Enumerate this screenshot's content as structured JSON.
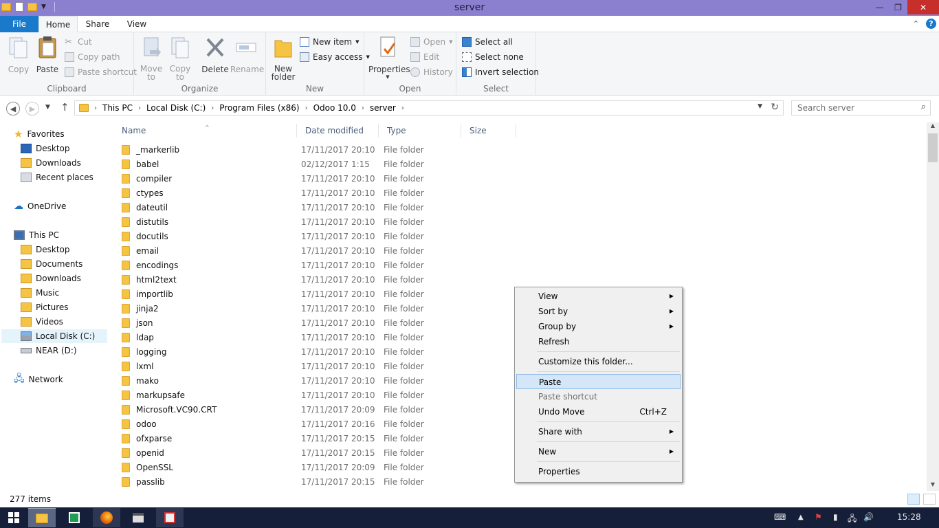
{
  "window": {
    "title": "server"
  },
  "ribbon_tabs": {
    "file": "File",
    "home": "Home",
    "share": "Share",
    "view": "View"
  },
  "clipboard": {
    "copy": "Copy",
    "paste": "Paste",
    "cut": "Cut",
    "copy_path": "Copy path",
    "paste_shortcut": "Paste shortcut",
    "label": "Clipboard"
  },
  "organize": {
    "move_to_1": "Move",
    "move_to_2": "to",
    "copy_to_1": "Copy",
    "copy_to_2": "to",
    "delete": "Delete",
    "rename": "Rename",
    "label": "Organize"
  },
  "new_group": {
    "new_folder_1": "New",
    "new_folder_2": "folder",
    "new_item": "New item",
    "easy_access": "Easy access",
    "label": "New"
  },
  "open_group": {
    "properties": "Properties",
    "open": "Open",
    "edit": "Edit",
    "history": "History",
    "label": "Open"
  },
  "select_group": {
    "select_all": "Select all",
    "select_none": "Select none",
    "invert": "Invert selection",
    "label": "Select"
  },
  "address": {
    "crumbs": [
      "This PC",
      "Local Disk (C:)",
      "Program Files (x86)",
      "Odoo 10.0",
      "server"
    ],
    "search_placeholder": "Search server"
  },
  "nav_pane": {
    "favorites": "Favorites",
    "fav_desktop": "Desktop",
    "fav_downloads": "Downloads",
    "fav_recent": "Recent places",
    "onedrive": "OneDrive",
    "thispc": "This PC",
    "pc_desktop": "Desktop",
    "pc_documents": "Documents",
    "pc_downloads": "Downloads",
    "pc_music": "Music",
    "pc_pictures": "Pictures",
    "pc_videos": "Videos",
    "pc_localdisk": "Local Disk (C:)",
    "pc_near": "NEAR (D:)",
    "network": "Network"
  },
  "columns": {
    "name": "Name",
    "date": "Date modified",
    "type": "Type",
    "size": "Size"
  },
  "files": [
    {
      "name": "_markerlib",
      "date": "17/11/2017 20:10",
      "type": "File folder"
    },
    {
      "name": "babel",
      "date": "02/12/2017 1:15",
      "type": "File folder"
    },
    {
      "name": "compiler",
      "date": "17/11/2017 20:10",
      "type": "File folder"
    },
    {
      "name": "ctypes",
      "date": "17/11/2017 20:10",
      "type": "File folder"
    },
    {
      "name": "dateutil",
      "date": "17/11/2017 20:10",
      "type": "File folder"
    },
    {
      "name": "distutils",
      "date": "17/11/2017 20:10",
      "type": "File folder"
    },
    {
      "name": "docutils",
      "date": "17/11/2017 20:10",
      "type": "File folder"
    },
    {
      "name": "email",
      "date": "17/11/2017 20:10",
      "type": "File folder"
    },
    {
      "name": "encodings",
      "date": "17/11/2017 20:10",
      "type": "File folder"
    },
    {
      "name": "html2text",
      "date": "17/11/2017 20:10",
      "type": "File folder"
    },
    {
      "name": "importlib",
      "date": "17/11/2017 20:10",
      "type": "File folder"
    },
    {
      "name": "jinja2",
      "date": "17/11/2017 20:10",
      "type": "File folder"
    },
    {
      "name": "json",
      "date": "17/11/2017 20:10",
      "type": "File folder"
    },
    {
      "name": "ldap",
      "date": "17/11/2017 20:10",
      "type": "File folder"
    },
    {
      "name": "logging",
      "date": "17/11/2017 20:10",
      "type": "File folder"
    },
    {
      "name": "lxml",
      "date": "17/11/2017 20:10",
      "type": "File folder"
    },
    {
      "name": "mako",
      "date": "17/11/2017 20:10",
      "type": "File folder"
    },
    {
      "name": "markupsafe",
      "date": "17/11/2017 20:10",
      "type": "File folder"
    },
    {
      "name": "Microsoft.VC90.CRT",
      "date": "17/11/2017 20:09",
      "type": "File folder"
    },
    {
      "name": "odoo",
      "date": "17/11/2017 20:16",
      "type": "File folder"
    },
    {
      "name": "ofxparse",
      "date": "17/11/2017 20:15",
      "type": "File folder"
    },
    {
      "name": "openid",
      "date": "17/11/2017 20:15",
      "type": "File folder"
    },
    {
      "name": "OpenSSL",
      "date": "17/11/2017 20:09",
      "type": "File folder"
    },
    {
      "name": "passlib",
      "date": "17/11/2017 20:15",
      "type": "File folder"
    }
  ],
  "status": {
    "count": "277 items"
  },
  "context_menu": {
    "view": "View",
    "sort_by": "Sort by",
    "group_by": "Group by",
    "refresh": "Refresh",
    "customize": "Customize this folder...",
    "paste": "Paste",
    "paste_shortcut": "Paste shortcut",
    "undo_move": "Undo Move",
    "undo_shortcut": "Ctrl+Z",
    "share_with": "Share with",
    "new": "New",
    "properties": "Properties"
  },
  "taskbar": {
    "clock": "15:28"
  },
  "colors": {
    "titlebar": "#8b7fd0",
    "file_tab": "#1979ca",
    "taskbar": "#161f3a",
    "highlight": "#d4e6f7"
  }
}
